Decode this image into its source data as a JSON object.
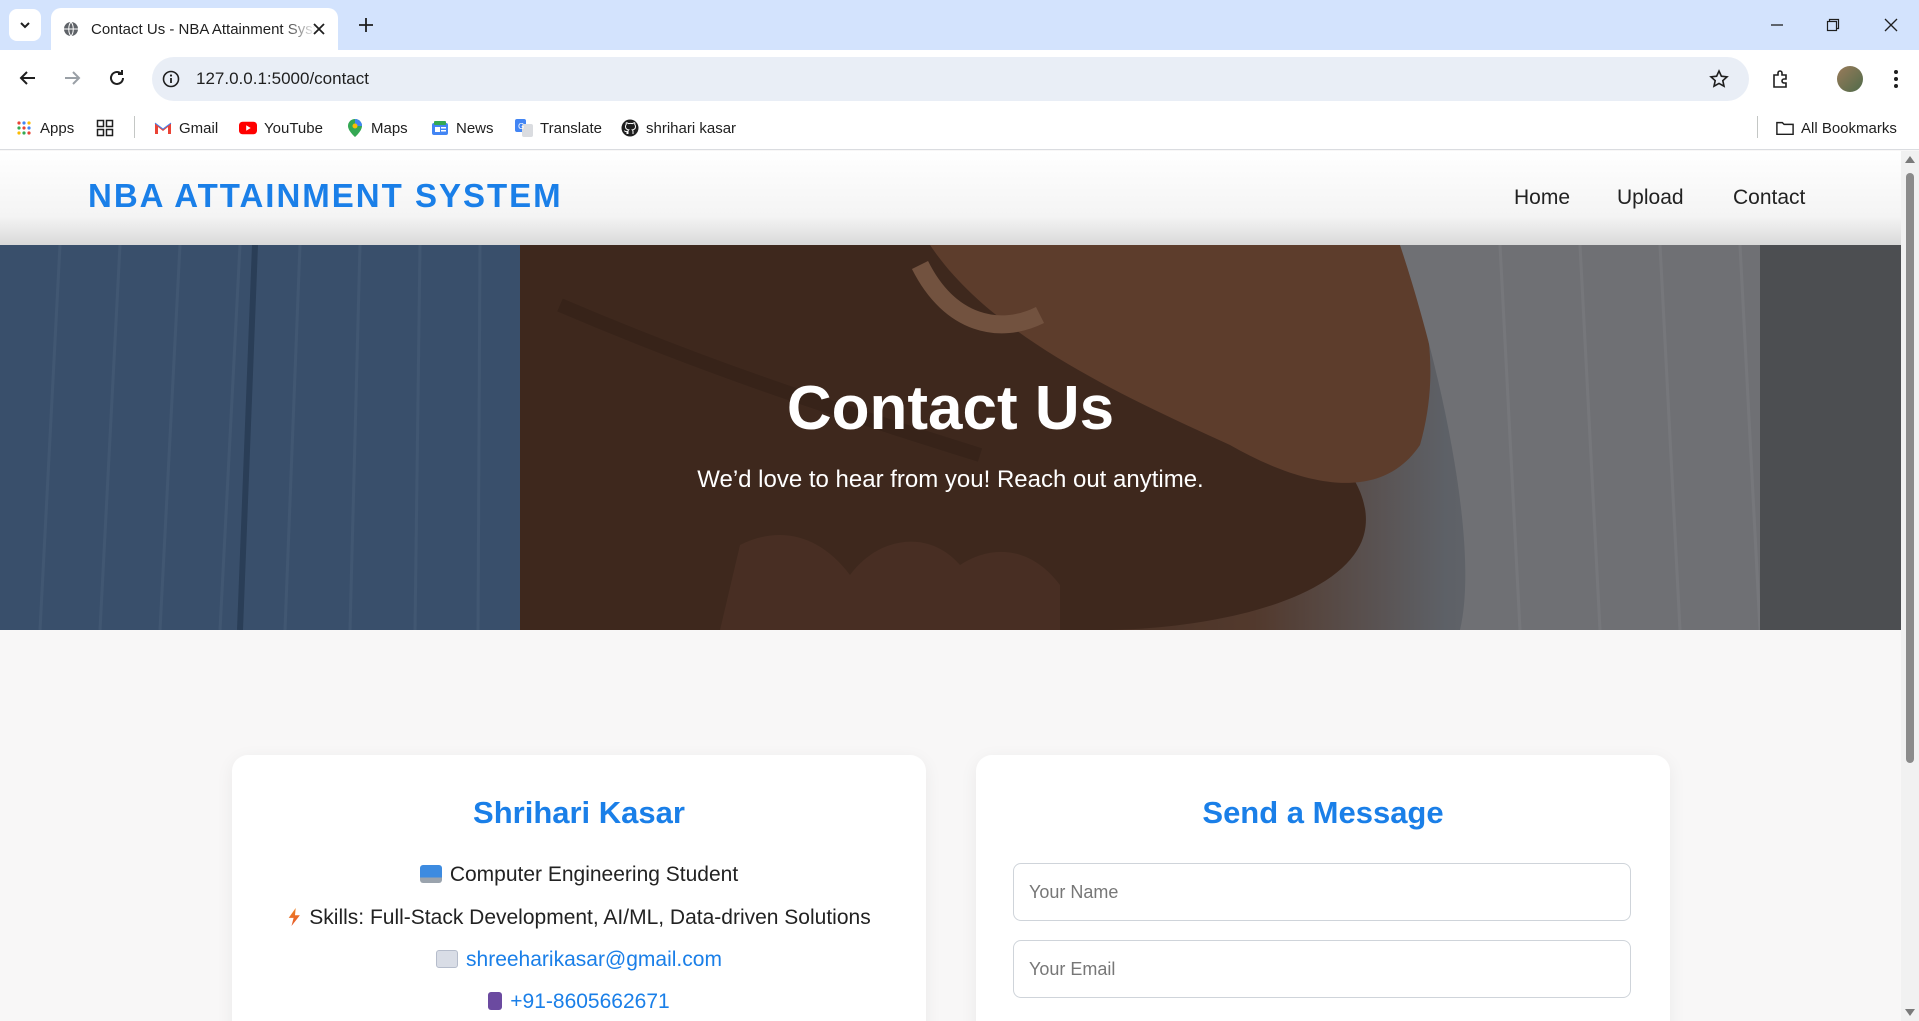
{
  "browser": {
    "tab_title": "Contact Us - NBA Attainment System",
    "url": "127.0.0.1:5000/contact",
    "bookmarks": [
      {
        "label": "Apps",
        "icon": "apps-grid-icon"
      },
      {
        "label": "",
        "icon": "tab-groups-icon"
      },
      {
        "label": "Gmail",
        "icon": "gmail-icon"
      },
      {
        "label": "YouTube",
        "icon": "youtube-icon"
      },
      {
        "label": "Maps",
        "icon": "maps-pin-icon"
      },
      {
        "label": "News",
        "icon": "news-icon"
      },
      {
        "label": "Translate",
        "icon": "translate-icon"
      },
      {
        "label": "shrihari kasar",
        "icon": "github-icon"
      }
    ],
    "all_bookmarks": "All Bookmarks"
  },
  "site": {
    "brand": "NBA ATTAINMENT SYSTEM",
    "nav": [
      "Home",
      "Upload",
      "Contact"
    ]
  },
  "hero": {
    "title": "Contact Us",
    "subtitle": "We’d love to hear from you! Reach out anytime."
  },
  "profile": {
    "name": "Shrihari Kasar",
    "role": "Computer Engineering Student",
    "skills": "Skills: Full-Stack Development, AI/ML, Data-driven Solutions",
    "email": "shreeharikasar@gmail.com",
    "phone": "+91-8605662671"
  },
  "message_form": {
    "title": "Send a Message",
    "name_placeholder": "Your Name",
    "email_placeholder": "Your Email"
  },
  "colors": {
    "accent": "#1a7fe8",
    "tabbar": "#d3e3fd"
  }
}
